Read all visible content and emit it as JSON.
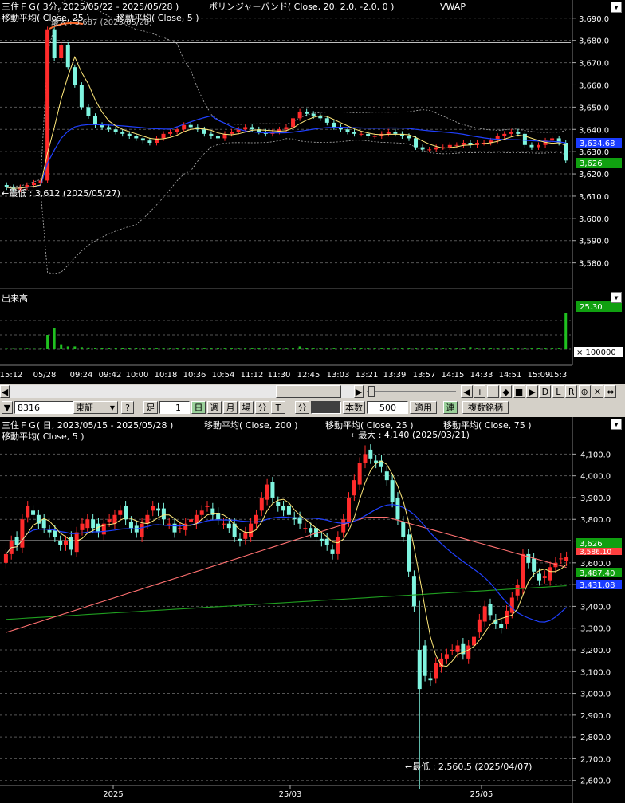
{
  "intraday": {
    "title": "三住ＦＧ( 3分, 2025/05/22 - 2025/05/28 )",
    "bb_label": "ボリンジャーバンド( Close, 20, 2.0, -2.0, 0 )",
    "vwap_label": "VWAP",
    "ma_label_1": "移動平均( Close, 25 )",
    "ma_label_2": "移動平均( Close, 5 )",
    "max_label": "最大 : 3,687 (2025/05/28)",
    "min_label": "←最低 : 3,612 (2025/05/27)",
    "price_badge_blue": "3,634.68",
    "price_badge_green": "3,626",
    "volume_title": "出来高",
    "volume_badge": "25.30",
    "volume_multiplier": "× 100000"
  },
  "toolbar": {
    "code": "8316",
    "market": "東証",
    "help": "?",
    "foot_label": "足",
    "foot_value": "1",
    "periods": [
      "日",
      "週",
      "月",
      "場",
      "分",
      "T"
    ],
    "minute_label": "分",
    "count_label": "本数",
    "count_value": "500",
    "apply": "適用",
    "link": "連",
    "multi": "複数銘柄",
    "nav_buttons": [
      "◀",
      "+",
      "−",
      "◆",
      "■",
      "▶",
      "D",
      "L",
      "R",
      "⊕",
      "✕",
      "⇔"
    ]
  },
  "colors": {
    "up": "#ff2b2b",
    "down": "#7ff5e0",
    "ma5": "#ffe87a",
    "ma25": "#2040ff",
    "ma75": "#ff7070",
    "ma200": "#20a020",
    "band": "#b0b0b0",
    "volume": "#20c020",
    "badge_blue": "#1a3cff",
    "badge_green": "#10a010",
    "badge_red": "#ff4040"
  },
  "chart_data": [
    {
      "type": "candlestick",
      "title": "三住ＦＧ( 3分, 2025/05/22 - 2025/05/28 )",
      "y_ticks": [
        "3,690.0",
        "3,680.0",
        "3,670.0",
        "3,660.0",
        "3,650.0",
        "3,640.0",
        "3,630.0",
        "3,620.0",
        "3,610.0",
        "3,600.0",
        "3,590.0",
        "3,580.0"
      ],
      "ylim": [
        3577,
        3691
      ],
      "x_ticks": [
        "15:12",
        "05/28",
        "09:24",
        "09:42",
        "10:00",
        "10:18",
        "10:36",
        "10:54",
        "11:12",
        "11:30",
        "12:45",
        "13:03",
        "13:21",
        "13:39",
        "13:57",
        "14:15",
        "14:33",
        "14:51",
        "15:09",
        "15:3"
      ],
      "series_close": [
        3614,
        3613,
        3614,
        3615,
        3616,
        3617,
        3685,
        3672,
        3678,
        3668,
        3660,
        3650,
        3646,
        3642,
        3641,
        3640,
        3639,
        3638,
        3637,
        3636,
        3635,
        3634,
        3636,
        3638,
        3639,
        3640,
        3642,
        3641,
        3640,
        3638,
        3637,
        3636,
        3638,
        3639,
        3640,
        3641,
        3640,
        3639,
        3638,
        3639,
        3640,
        3641,
        3645,
        3648,
        3647,
        3646,
        3645,
        3643,
        3641,
        3640,
        3639,
        3638,
        3638,
        3637,
        3637,
        3638,
        3639,
        3638,
        3637,
        3636,
        3632,
        3631,
        3631,
        3632,
        3632,
        3633,
        3633,
        3634,
        3633,
        3634,
        3634,
        3635,
        3637,
        3638,
        3639,
        3638,
        3633,
        3632,
        3633,
        3635,
        3636,
        3634,
        3626
      ],
      "ma5_end": 3634.68,
      "last": 3626,
      "max": {
        "value": 3687,
        "date": "2025/05/28"
      },
      "min": {
        "value": 3612,
        "date": "2025/05/27"
      }
    },
    {
      "type": "bar",
      "title": "出来高",
      "ylim": [
        0,
        30
      ],
      "last": 25.3,
      "unit": "× 100000",
      "values": [
        0.3,
        0.3,
        0.3,
        0.4,
        0.3,
        0.4,
        10,
        15,
        3,
        2,
        2,
        1.5,
        1.2,
        1,
        1,
        0.8,
        0.8,
        0.8,
        0.6,
        0.6,
        0.6,
        0.5,
        0.5,
        0.5,
        0.5,
        0.5,
        0.5,
        0.5,
        0.5,
        0.5,
        0.5,
        0.5,
        0.5,
        0.5,
        0.5,
        0.5,
        0.5,
        0.5,
        0.5,
        0.5,
        0.5,
        0.5,
        0.5,
        2,
        0.8,
        0.5,
        0.5,
        0.5,
        0.5,
        0.5,
        0.5,
        0.5,
        0.5,
        0.5,
        0.5,
        0.5,
        0.5,
        0.5,
        0.5,
        0.5,
        0.5,
        0.5,
        0.5,
        0.5,
        0.5,
        0.5,
        0.5,
        0.5,
        1.5,
        0.5,
        0.5,
        0.5,
        0.5,
        0.5,
        0.5,
        0.5,
        0.5,
        0.5,
        0.5,
        0.5,
        0.5,
        0.5,
        25.3
      ]
    },
    {
      "type": "candlestick",
      "title": "三住ＦＧ( 日, 2023/05/15 - 2025/05/28 )",
      "labels": [
        "移動平均( Close, 200 )",
        "移動平均( Close, 25 )",
        "移動平均( Close, 75 )",
        "移動平均( Close, 5 )"
      ],
      "y_ticks": [
        "4,100.0",
        "4,000.0",
        "3,900.0",
        "3,800.0",
        "3,700.0",
        "3,600.0",
        "3,500.0",
        "3,400.0",
        "3,300.0",
        "3,200.0",
        "3,100.0",
        "3,000.0",
        "2,900.0",
        "2,800.0",
        "2,700.0",
        "2,600.0"
      ],
      "ylim": [
        2555,
        4160
      ],
      "x_ticks": [
        "2025",
        "25/03",
        "25/05"
      ],
      "series_close": [
        3640,
        3700,
        3680,
        3800,
        3860,
        3820,
        3780,
        3760,
        3740,
        3720,
        3680,
        3700,
        3660,
        3740,
        3780,
        3800,
        3760,
        3740,
        3780,
        3800,
        3820,
        3840,
        3800,
        3760,
        3740,
        3780,
        3820,
        3860,
        3840,
        3800,
        3780,
        3740,
        3760,
        3780,
        3800,
        3820,
        3840,
        3860,
        3820,
        3800,
        3780,
        3760,
        3720,
        3700,
        3740,
        3780,
        3820,
        3900,
        3960,
        3900,
        3860,
        3840,
        3820,
        3800,
        3780,
        3760,
        3740,
        3720,
        3700,
        3680,
        3640,
        3720,
        3800,
        3900,
        3980,
        4060,
        4100,
        4080,
        4060,
        4040,
        3980,
        3880,
        3800,
        3720,
        3560,
        3400,
        3200,
        3080,
        3060,
        3140,
        3160,
        3180,
        3200,
        3220,
        3180,
        3220,
        3260,
        3340,
        3400,
        3360,
        3320,
        3300,
        3380,
        3440,
        3500,
        3640,
        3600,
        3560,
        3520,
        3540,
        3580,
        3600,
        3620,
        3626
      ],
      "last": 3626,
      "ma_end_labels": {
        "ma75": "3,586.10",
        "ma200": "3,487.40",
        "ma25": "3,431.08"
      },
      "max": {
        "value": 4140,
        "date": "2025/03/21"
      },
      "min": {
        "value": 2560.5,
        "date": "2025/04/07"
      }
    }
  ],
  "daily": {
    "title": "三住ＦＧ( 日, 2023/05/15 - 2025/05/28 )",
    "ma200_label": "移動平均( Close, 200 )",
    "ma25_label": "移動平均( Close, 25 )",
    "ma75_label": "移動平均( Close, 75 )",
    "ma5_label": "移動平均( Close, 5 )",
    "max_label": "←最大 : 4,140 (2025/03/21)",
    "min_label": "←最低 : 2,560.5 (2025/04/07)",
    "badge_green": "3,626",
    "badge_red": "3,586.10",
    "badge_ma200": "3,487.40",
    "badge_ma25": "3,431.08"
  }
}
